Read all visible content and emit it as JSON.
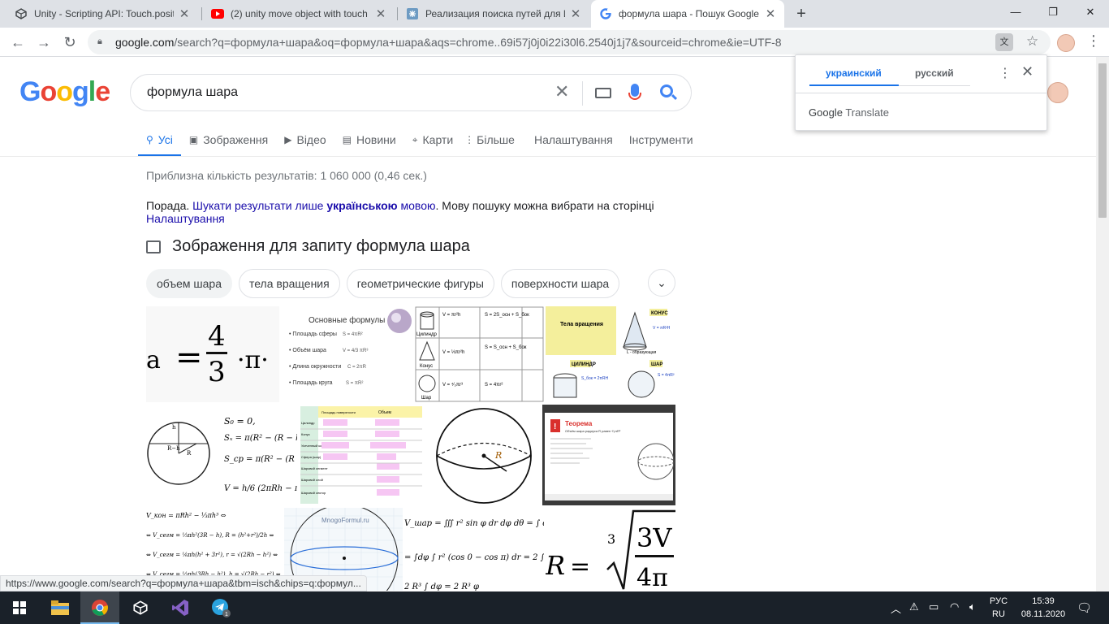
{
  "browser": {
    "tabs": [
      {
        "title": "Unity - Scripting API: Touch.positi",
        "favicon": "unity-icon"
      },
      {
        "title": "(2) unity move object with touch",
        "favicon": "youtube-icon"
      },
      {
        "title": "Реализация поиска путей для И",
        "favicon": "habr-icon"
      },
      {
        "title": "формула шара - Пошук Google",
        "favicon": "google-icon",
        "active": true
      }
    ],
    "url": {
      "host": "google.com",
      "path": "/search?q=формула+шара&oq=формула+шара&aqs=chrome..69i57j0j0i22i30l6.2540j1j7&sourceid=chrome&ie=UTF-8"
    }
  },
  "google": {
    "logo": "Google",
    "query": "формула шара",
    "tabs": [
      {
        "label": "Усі",
        "icon": "search-icon",
        "active": true
      },
      {
        "label": "Зображення",
        "icon": "image-icon"
      },
      {
        "label": "Відео",
        "icon": "video-icon"
      },
      {
        "label": "Новини",
        "icon": "news-icon"
      },
      {
        "label": "Карти",
        "icon": "map-pin-icon"
      },
      {
        "label": "Більше",
        "icon": "more-vert-icon"
      },
      {
        "label": "Налаштування"
      },
      {
        "label": "Інструменти"
      }
    ],
    "stats": "Приблизна кількість результатів: 1 060 000 (0,46 сек.)",
    "tip": {
      "prefix": "Порада. ",
      "link1": "Шукати результати лише ",
      "bold": "українською",
      "link2": " мовою",
      "suffix": ". Мову пошуку можна вибрати на сторінці ",
      "settings_link": "Налаштування"
    },
    "images_heading": "Зображення для запиту формула шара",
    "chips": [
      "объем шара",
      "тела вращения",
      "геометрические фигуры",
      "поверхности шара"
    ]
  },
  "thumbs": {
    "t1": {
      "a": "a",
      "eq": "=",
      "num": "4",
      "den": "3",
      "tail": "·π·"
    },
    "t2": {
      "title": "Основные формулы",
      "items": [
        "Площадь сферы",
        "Объём шара",
        "Длина окружности",
        "Площадь круга"
      ],
      "f1": "S = 4πR²",
      "f2": "V = 4/3 πR³",
      "f3": "C = 2πR",
      "f4": "S = πR²"
    },
    "t3": {
      "rows": [
        "Цилиндр",
        "Конус",
        "Шар"
      ],
      "f1": "V = πr²h",
      "f2": "S = 2S_осн + S_бок",
      "f3": "V = ⅓πr²h",
      "f4": "S = S_осн + S_бок",
      "f5": "V = ⁴⁄₃πr³",
      "f6": "S = 4πr²"
    },
    "t4": {
      "title": "Тела вращения",
      "konus": "КОНУС",
      "cil": "ЦИЛИНДР",
      "shar": "ШАР",
      "l": "L - образующая",
      "f1": "S_бок = 2πRH",
      "f2": "V = πR²H",
      "f3": "S = 4πR²"
    },
    "t5": {
      "s0": "S₀ = 0,",
      "s1": "Sₓ = π(R² − (R − h)²",
      "s2": "S_ср = π(R² − (R − h/2",
      "v": "V = h/6 (2πRh − πh² +",
      "h": "h",
      "rh": "R−h",
      "r": "R"
    },
    "t6": {
      "h1": "Площадь поверхности",
      "h2": "Объем",
      "rows": [
        "Цилиндр",
        "Конус",
        "Усеченный конус",
        "Сфера (шар)",
        "Шаровой сегмент",
        "Шаровой слой",
        "Шаровой сектор"
      ]
    },
    "t7": {
      "r": "R"
    },
    "t8": {
      "title": "Теорема",
      "text": "Объём шара радиуса R равен ⁴⁄₃πR³"
    },
    "t9": {
      "l1": "V_кон = πRh² − ⅓πh³ ⇔",
      "l2": "⇔ V_сегм = ⅓πh²(3R − h), R = (h²+r²)/2h ⇔",
      "l3": "⇔ V_сегм = ⅙πh(h² + 3r²), r = √(2Rh − h²) ⇔",
      "l4": "⇔ V_сегм = ⅓πh(3Rh − h²), h = √(2Rh − r²) ⇔"
    },
    "t10": {
      "site": "MnogoFormul.ru"
    },
    "t11": {
      "l1": "V_шар = ∭ r² sin φ dr dφ dθ = ∫ dφ",
      "l2": "= ∫dφ ∫ r² (cos 0 − cos π) dr = 2 ∫",
      "l3": "2 R³ ∫ dφ = 2 R³ φ"
    },
    "t12": {
      "r": "R",
      "eq": "=",
      "three": "3",
      "num": "3V",
      "den": "4π"
    }
  },
  "translate_popup": {
    "lang_ua": "украинский",
    "lang_ru": "русский",
    "brand": "Google",
    "product": "Translate"
  },
  "status_url": "https://www.google.com/search?q=формула+шара&tbm=isch&chips=q:формул...",
  "taskbar": {
    "lang_top": "РУС",
    "lang_bottom": "RU",
    "time": "15:39",
    "date": "08.11.2020",
    "tg_badge": "1"
  },
  "colors": {
    "blue": "#4285f4",
    "red": "#ea4335",
    "yellow": "#fbbc05",
    "green": "#34a853",
    "link": "#1a0dab",
    "accent": "#1a73e8"
  }
}
